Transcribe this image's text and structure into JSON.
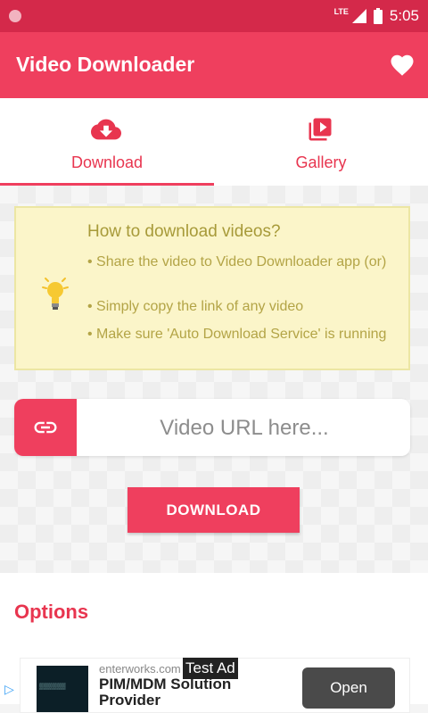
{
  "status_bar": {
    "network": "LTE",
    "time": "5:05"
  },
  "app_bar": {
    "title": "Video Downloader",
    "favorite_icon": "heart-icon"
  },
  "tabs": [
    {
      "label": "Download",
      "icon": "cloud-download-icon",
      "selected": true
    },
    {
      "label": "Gallery",
      "icon": "video-library-icon",
      "selected": false
    }
  ],
  "info": {
    "title": "How to download videos?",
    "bullets": [
      "•  Share the video to Video Downloader app (or)",
      "•  Simply copy the link of any video",
      "•  Make sure 'Auto Download Service' is running"
    ]
  },
  "url_input": {
    "placeholder": "Video URL here...",
    "value": ""
  },
  "download_button": {
    "label": "DOWNLOAD"
  },
  "options": {
    "title": "Options"
  },
  "ad": {
    "domain": "enterworks.com",
    "badge": "Test Ad",
    "title": "PIM/MDM Solution Provider",
    "cta": "Open"
  },
  "colors": {
    "primary": "#ef3f5e",
    "status_bar": "#d4294a",
    "info_bg": "#fbf5c9",
    "info_text": "#b3a446"
  }
}
